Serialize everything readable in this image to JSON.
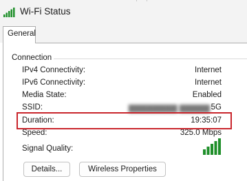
{
  "window": {
    "title": "Wi-Fi Status",
    "icon": "wifi-signal-icon"
  },
  "tabs": [
    {
      "label": "General",
      "selected": true
    }
  ],
  "connection": {
    "group_label": "Connection",
    "rows": [
      {
        "label": "IPv4 Connectivity:",
        "value": "Internet"
      },
      {
        "label": "IPv6 Connectivity:",
        "value": "Internet"
      },
      {
        "label": "Media State:",
        "value": "Enabled"
      },
      {
        "label": "SSID:",
        "value_suffix": "5G"
      },
      {
        "label": "Duration:",
        "value": "19:35:07"
      },
      {
        "label": "Speed:",
        "value": "325.0 Mbps"
      }
    ],
    "signal_quality": {
      "label": "Signal Quality:",
      "bars_filled": 5,
      "bars_total": 5
    }
  },
  "buttons": {
    "details": "Details...",
    "wireless_properties": "Wireless Properties"
  },
  "colors": {
    "highlight": "#c9242b",
    "signal": "#1f8f2a"
  }
}
